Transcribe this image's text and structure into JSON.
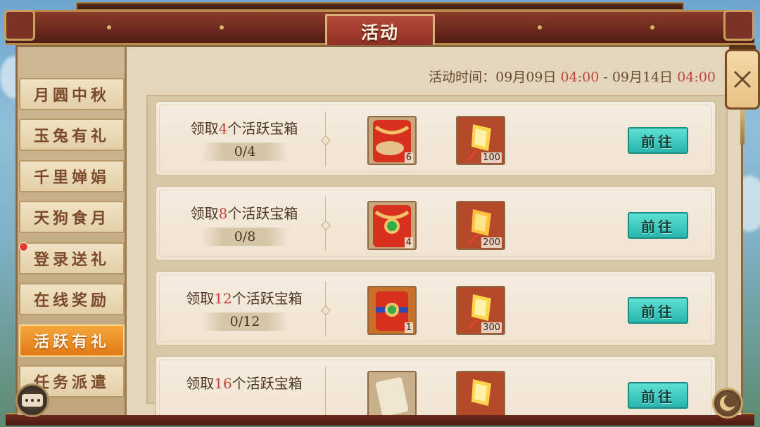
{
  "window": {
    "title": "活动"
  },
  "close_button": {
    "icon": "close-icon"
  },
  "event_time": {
    "label": "活动时间：",
    "start_date": "09月09日",
    "start_time": "04:00",
    "separator": "-",
    "end_date": "09月14日",
    "end_time": "04:00"
  },
  "sidebar": {
    "items": [
      {
        "label": "月圆中秋",
        "active": false,
        "badge": false
      },
      {
        "label": "玉兔有礼",
        "active": false,
        "badge": false
      },
      {
        "label": "千里婵娟",
        "active": false,
        "badge": false
      },
      {
        "label": "天狗食月",
        "active": false,
        "badge": false
      },
      {
        "label": "登录送礼",
        "active": false,
        "badge": true
      },
      {
        "label": "在线奖励",
        "active": false,
        "badge": false
      },
      {
        "label": "活跃有礼",
        "active": true,
        "badge": false
      },
      {
        "label": "任务派遣",
        "active": false,
        "badge": false
      }
    ]
  },
  "tasks": [
    {
      "prefix": "领取",
      "count": "4",
      "suffix": "个活跃宝箱",
      "progress": "0/4",
      "rewards": [
        {
          "icon": "red-envelope-icon",
          "count": "6"
        },
        {
          "icon": "sky-lantern-icon",
          "count": "100"
        }
      ],
      "button": "前往"
    },
    {
      "prefix": "领取",
      "count": "8",
      "suffix": "个活跃宝箱",
      "progress": "0/8",
      "rewards": [
        {
          "icon": "jade-red-envelope-icon",
          "count": "4"
        },
        {
          "icon": "sky-lantern-icon",
          "count": "200"
        }
      ],
      "button": "前往"
    },
    {
      "prefix": "领取",
      "count": "12",
      "suffix": "个活跃宝箱",
      "progress": "0/12",
      "rewards": [
        {
          "icon": "jade-gift-pouch-icon",
          "count": "1"
        },
        {
          "icon": "sky-lantern-icon",
          "count": "300"
        }
      ],
      "button": "前往"
    },
    {
      "prefix": "领取",
      "count": "16",
      "suffix": "个活跃宝箱",
      "progress": "",
      "rewards": [
        {
          "icon": "scroll-icon",
          "count": ""
        },
        {
          "icon": "sky-lantern-icon",
          "count": ""
        }
      ],
      "button": "前往"
    }
  ],
  "colors": {
    "highlight_red": "#c0443a",
    "active_tab": "#f08a22",
    "go_button": "#3cc8bf"
  }
}
